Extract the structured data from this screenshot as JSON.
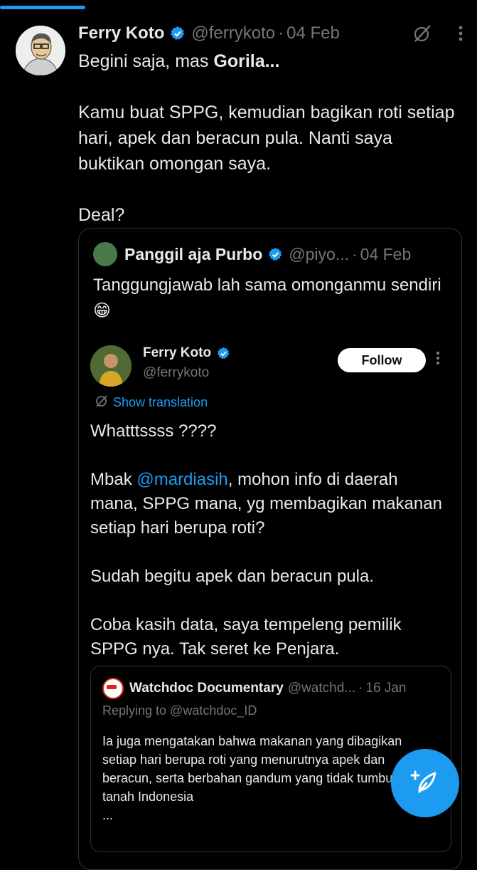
{
  "post": {
    "author_name": "Ferry Koto",
    "author_handle": "@ferrykoto",
    "date": "04 Feb",
    "lines": [
      "Begini saja, mas ",
      "Gorila...",
      "Kamu buat SPPG, kemudian bagikan roti setiap hari, apek dan beracun pula. Nanti saya buktikan omongan saya.",
      "Deal?"
    ]
  },
  "quote": {
    "author_name": "Panggil aja Purbo",
    "author_handle": "@piyo...",
    "date": "04 Feb",
    "text": "Tanggungjawab lah sama omonganmu sendiri 😁",
    "embedded": {
      "author_name": "Ferry Koto",
      "author_handle": "@ferrykoto",
      "follow_label": "Follow",
      "show_translation": "Show translation",
      "p1": "Whatttssss ????",
      "p2_prefix": "Mbak ",
      "p2_mention": "@mardiasih",
      "p2_suffix": ", mohon info di daerah mana, SPPG mana, yg membagikan makanan setiap hari berupa roti?",
      "p3": "Sudah begitu apek dan beracun pula.",
      "p4": "Coba kasih data, saya tempeleng pemilik SPPG nya. Tak seret ke Penjara.",
      "inner_quote": {
        "author_name": "Watchdoc Documentary",
        "author_handle": "@watchd...",
        "date": "16 Jan",
        "replying_to": "Replying to @watchdoc_ID",
        "text": "Ia juga mengatakan bahwa makanan yang dibagikan setiap hari berupa roti yang menurutnya apek dan beracun, serta berbahan gandum yang tidak tumbuh di tanah Indonesia",
        "ellipsis": "..."
      }
    }
  },
  "colors": {
    "accent": "#1d9bf0",
    "background": "#000000",
    "muted": "#71767b",
    "text": "#e7e9ea"
  },
  "icons": [
    "verified-badge-icon",
    "grok-icon",
    "more-icon",
    "translate-icon",
    "compose-post-icon"
  ]
}
